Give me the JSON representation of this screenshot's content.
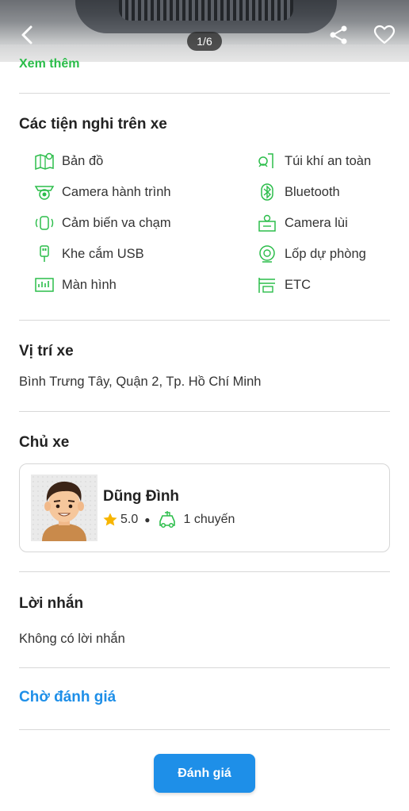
{
  "gallery": {
    "counter": "1/6",
    "see_more_label": "Xem thêm"
  },
  "amenities": {
    "title": "Các tiện nghi trên xe",
    "items": [
      {
        "label": "Bản đồ",
        "icon": "map-icon"
      },
      {
        "label": "Túi khí an toàn",
        "icon": "airbag-icon"
      },
      {
        "label": "Camera hành trình",
        "icon": "dashcam-icon"
      },
      {
        "label": "Bluetooth",
        "icon": "bluetooth-icon"
      },
      {
        "label": "Cảm biến va chạm",
        "icon": "collision-sensor-icon"
      },
      {
        "label": "Camera lùi",
        "icon": "reverse-camera-icon"
      },
      {
        "label": "Khe cắm USB",
        "icon": "usb-icon"
      },
      {
        "label": "Lốp dự phòng",
        "icon": "spare-tire-icon"
      },
      {
        "label": "Màn hình",
        "icon": "screen-icon"
      },
      {
        "label": "ETC",
        "icon": "etc-icon"
      }
    ]
  },
  "location": {
    "title": "Vị trí xe",
    "address": "Bình Trưng Tây, Quận 2, Tp. Hồ Chí Minh"
  },
  "owner": {
    "title": "Chủ xe",
    "name": "Dũng Đình",
    "rating": "5.0",
    "trips": "1 chuyến"
  },
  "message": {
    "title": "Lời nhắn",
    "text": "Không có lời nhắn"
  },
  "review": {
    "status_link": "Chờ đánh giá",
    "button_label": "Đánh giá"
  },
  "colors": {
    "accent_green": "#2bbd4a",
    "accent_blue": "#1e8fe8",
    "star": "#f7b500"
  }
}
